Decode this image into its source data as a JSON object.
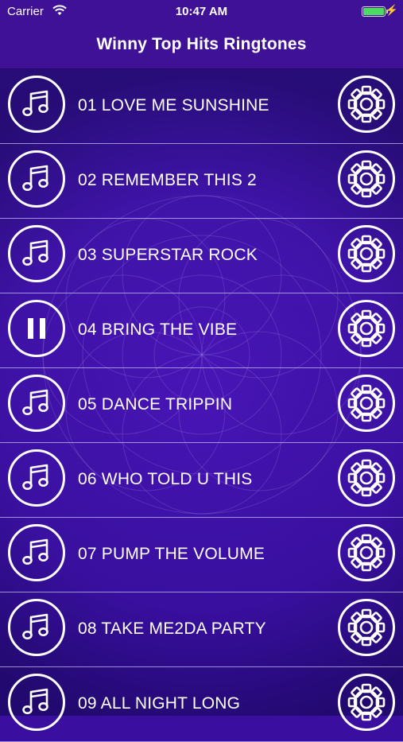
{
  "status_bar": {
    "carrier": "Carrier",
    "time": "10:47 AM",
    "battery_level": 1.0
  },
  "nav": {
    "title": "Winny Top Hits Ringtones"
  },
  "colors": {
    "nav_background": "#3f1196",
    "list_background": "#4a16b8",
    "battery": "#4cd964"
  },
  "tracks": [
    {
      "label": "01 LOVE ME SUNSHINE",
      "icon": "music-note-icon",
      "playing": false
    },
    {
      "label": "02 REMEMBER THIS 2",
      "icon": "music-note-icon",
      "playing": false
    },
    {
      "label": "03 SUPERSTAR ROCK",
      "icon": "music-note-icon",
      "playing": false
    },
    {
      "label": "04 BRING THE VIBE",
      "icon": "pause-icon",
      "playing": true
    },
    {
      "label": "05 DANCE TRIPPIN",
      "icon": "music-note-icon",
      "playing": false
    },
    {
      "label": "06 WHO TOLD U THIS",
      "icon": "music-note-icon",
      "playing": false
    },
    {
      "label": "07 PUMP THE VOLUME",
      "icon": "music-note-icon",
      "playing": false
    },
    {
      "label": "08 TAKE ME2DA PARTY",
      "icon": "music-note-icon",
      "playing": false
    },
    {
      "label": "09 ALL NIGHT LONG",
      "icon": "music-note-icon",
      "playing": false
    }
  ],
  "settings_icon": "gear-icon"
}
